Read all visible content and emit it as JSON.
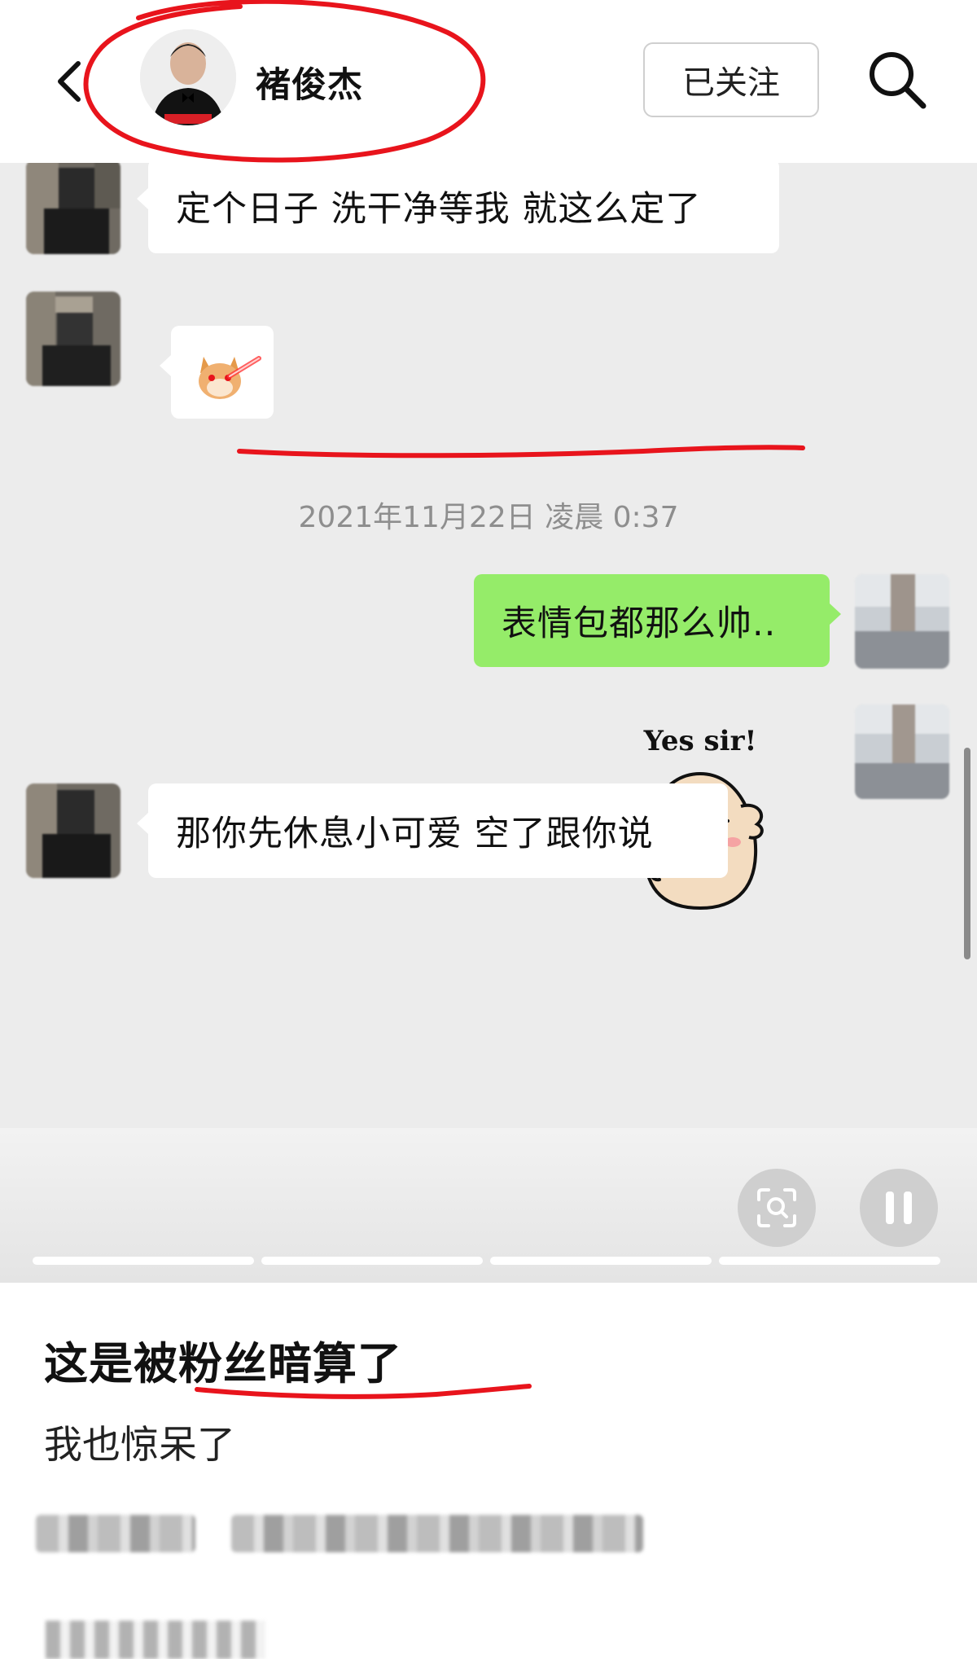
{
  "header": {
    "user_name": "褚俊杰",
    "follow_label": "已关注",
    "back_icon": "chevron-left-icon",
    "search_icon": "search-icon"
  },
  "chat": {
    "messages": [
      {
        "side": "in",
        "type": "text",
        "text": "定个日子 洗干净等我 就这么定了"
      },
      {
        "side": "in",
        "type": "sticker",
        "sticker": "shiba-laser-eyes-sticker"
      },
      {
        "side": "out",
        "type": "text",
        "text": "表情包都那么帅.."
      },
      {
        "side": "out",
        "type": "sticker",
        "sticker": "potato-salute-sticker",
        "caption": "Yes sir!"
      },
      {
        "side": "in",
        "type": "text",
        "text": "那你先休息小可爱 空了跟你说"
      }
    ],
    "timestamp": "2021年11月22日 凌晨 0:37"
  },
  "controls": {
    "scan_icon": "scan-icon",
    "pause_icon": "pause-icon",
    "progress_segments": 4
  },
  "post": {
    "title": "这是被粉丝暗算了",
    "body": "我也惊呆了"
  },
  "colors": {
    "outgoing_bubble": "#95ec69",
    "chat_background": "#ececec",
    "annotation_red": "#e8141c"
  }
}
